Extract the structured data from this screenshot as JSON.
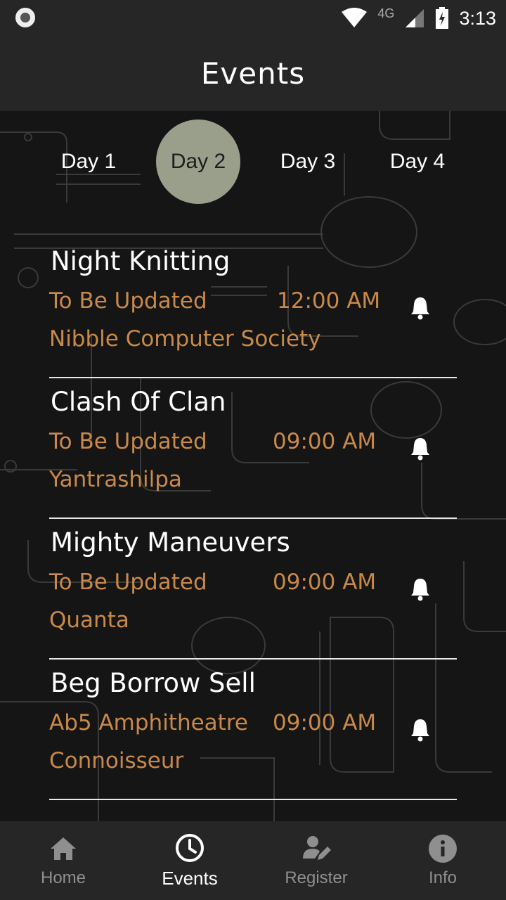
{
  "status_bar": {
    "network": "4G",
    "time": "3:13"
  },
  "app_bar": {
    "title": "Events"
  },
  "day_tabs": [
    {
      "label": "Day 1",
      "active": false
    },
    {
      "label": "Day 2",
      "active": true
    },
    {
      "label": "Day 3",
      "active": false
    },
    {
      "label": "Day 4",
      "active": false
    }
  ],
  "events": [
    {
      "title": "Night Knitting",
      "venue": "To Be Updated",
      "time": "12:00 AM",
      "club": "Nibble Computer Society"
    },
    {
      "title": "Clash Of Clan",
      "venue": "To Be Updated",
      "time": "09:00 AM",
      "club": "Yantrashilpa"
    },
    {
      "title": "Mighty Maneuvers",
      "venue": "To Be Updated",
      "time": "09:00 AM",
      "club": "Quanta"
    },
    {
      "title": "Beg Borrow Sell",
      "venue": "Ab5 Amphitheatre",
      "time": "09:00 AM",
      "club": "Connoisseur"
    }
  ],
  "bottom_nav": [
    {
      "label": "Home",
      "icon": "home-icon",
      "active": false
    },
    {
      "label": "Events",
      "icon": "clock-icon",
      "active": true
    },
    {
      "label": "Register",
      "icon": "register-icon",
      "active": false
    },
    {
      "label": "Info",
      "icon": "info-icon",
      "active": false
    }
  ],
  "colors": {
    "accent_text": "#c9894a",
    "active_tab": "#9a9f8c",
    "bar_background": "#262626"
  }
}
